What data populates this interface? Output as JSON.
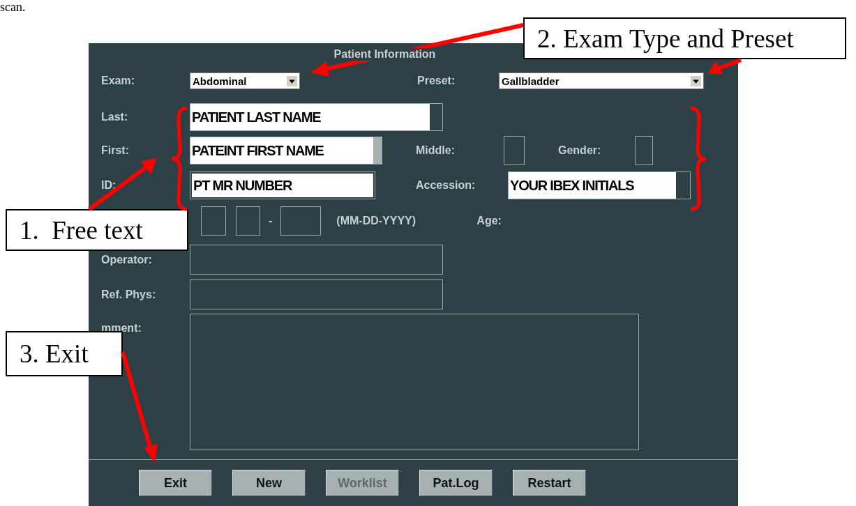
{
  "page_text": "scan.",
  "panel": {
    "title": "Patient Information",
    "exam": {
      "label": "Exam:",
      "value": "Abdominal"
    },
    "preset": {
      "label": "Preset:",
      "value": "Gallbladder"
    },
    "last": {
      "label": "Last:",
      "value": "PATIENT LAST NAME"
    },
    "first": {
      "label": "First:",
      "value": "PATEINT FIRST NAME"
    },
    "middle": {
      "label": "Middle:"
    },
    "gender": {
      "label": "Gender:"
    },
    "id": {
      "label": "ID:",
      "value": "PT MR NUMBER"
    },
    "accession": {
      "label": "Accession:",
      "value": "YOUR IBEX INITIALS"
    },
    "dob": {
      "separator": "-",
      "format": "(MM-DD-YYYY)",
      "age_label": "Age:"
    },
    "operator": {
      "label": "Operator:"
    },
    "ref_phys": {
      "label": "Ref. Phys:"
    },
    "comment": {
      "label": "mment:"
    }
  },
  "buttons": [
    {
      "label": "Exit",
      "disabled": false
    },
    {
      "label": "New",
      "disabled": false
    },
    {
      "label": "Worklist",
      "disabled": true
    },
    {
      "label": "Pat.Log",
      "disabled": false
    },
    {
      "label": "Restart",
      "disabled": false
    }
  ],
  "callouts": [
    {
      "text": "2. Exam Type and Preset"
    },
    {
      "text": "1.  Free text"
    },
    {
      "text": "3. Exit"
    }
  ]
}
